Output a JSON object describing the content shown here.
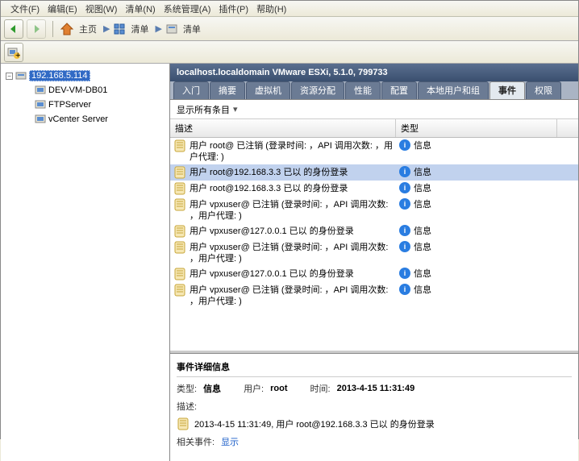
{
  "menubar": {
    "items": [
      "文件(F)",
      "编辑(E)",
      "视图(W)",
      "清单(N)",
      "系统管理(A)",
      "插件(P)",
      "帮助(H)"
    ]
  },
  "toolbar": {
    "home_label": "主页",
    "inventory_label_1": "清单",
    "inventory_label_2": "清单"
  },
  "tree": {
    "root_label": "192.168.5.114",
    "children": [
      {
        "label": "DEV-VM-DB01"
      },
      {
        "label": "FTPServer"
      },
      {
        "label": "vCenter Server"
      }
    ]
  },
  "content_title": "localhost.localdomain VMware ESXi, 5.1.0, 799733",
  "tabs": [
    "入门",
    "摘要",
    "虚拟机",
    "资源分配",
    "性能",
    "配置",
    "本地用户和组",
    "事件",
    "权限"
  ],
  "active_tab": "事件",
  "filter_label": "显示所有条目",
  "table": {
    "headers": {
      "desc": "描述",
      "type": "类型"
    },
    "type_info": "信息",
    "rows": [
      {
        "desc": "用户 root@ 已注销 (登录时间: ，API 调用次数: ，用户代理: )"
      },
      {
        "desc": "用户 root@192.168.3.3 已以  的身份登录",
        "selected": true
      },
      {
        "desc": "用户 root@192.168.3.3 已以  的身份登录"
      },
      {
        "desc": "用户 vpxuser@ 已注销 (登录时间: ，API 调用次数: ，用户代理: )"
      },
      {
        "desc": "用户 vpxuser@127.0.0.1 已以  的身份登录"
      },
      {
        "desc": "用户 vpxuser@ 已注销 (登录时间: ，API 调用次数: ，用户代理: )"
      },
      {
        "desc": "用户 vpxuser@127.0.0.1 已以  的身份登录"
      },
      {
        "desc": "用户 vpxuser@ 已注销 (登录时间: ，API 调用次数: ，用户代理: )"
      }
    ]
  },
  "details": {
    "title": "事件详细信息",
    "type_label": "类型:",
    "type_value": "信息",
    "user_label": "用户:",
    "user_value": "root",
    "time_label": "时间:",
    "time_value": "2013-4-15 11:31:49",
    "desc_label": "描述:",
    "desc_text": "2013-4-15 11:31:49,   用户 root@192.168.3.3 已以  的身份登录",
    "related_label": "相关事件:",
    "show_link": "显示"
  }
}
